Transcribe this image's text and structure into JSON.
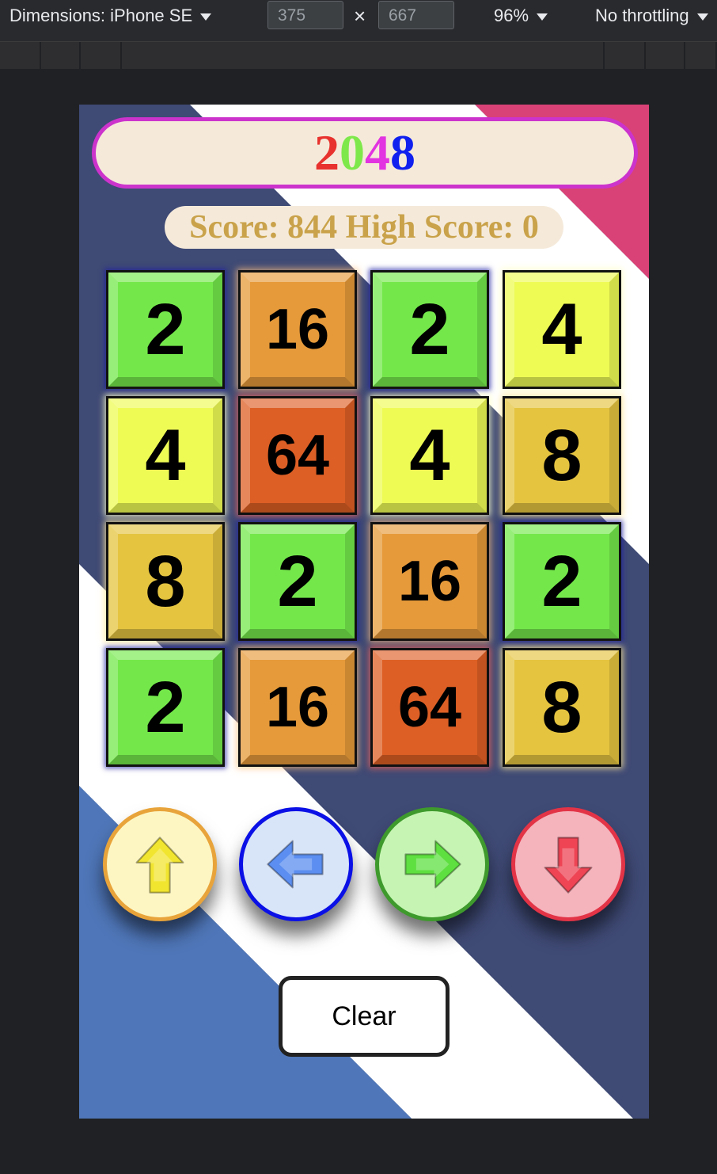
{
  "devtools": {
    "device_label": "Dimensions: iPhone SE",
    "width_value": "375",
    "height_value": "667",
    "times": "×",
    "zoom": "96%",
    "throttle": "No throttling"
  },
  "game": {
    "title_chars": [
      {
        "ch": "2",
        "color": "#e8322e"
      },
      {
        "ch": "0",
        "color": "#7ee84b"
      },
      {
        "ch": "4",
        "color": "#e234e0"
      },
      {
        "ch": "8",
        "color": "#1020ee"
      }
    ],
    "score_text": "Score: 844 High Score: 0",
    "board": [
      [
        "2",
        "16",
        "2",
        "4"
      ],
      [
        "4",
        "64",
        "4",
        "8"
      ],
      [
        "8",
        "2",
        "16",
        "2"
      ],
      [
        "2",
        "16",
        "64",
        "8"
      ]
    ],
    "controls": [
      {
        "name": "up-button",
        "icon": "arrow-up-icon",
        "fill": "#fdf6c3",
        "ring": "#e8a43a",
        "arrow": "#f2e530"
      },
      {
        "name": "left-button",
        "icon": "arrow-left-icon",
        "fill": "#d8e4f8",
        "ring": "#0a10e6",
        "arrow": "#5b8ef0"
      },
      {
        "name": "right-button",
        "icon": "arrow-right-icon",
        "fill": "#c6f5b3",
        "ring": "#3e9a2c",
        "arrow": "#5ee040"
      },
      {
        "name": "down-button",
        "icon": "arrow-down-icon",
        "fill": "#f5b3bc",
        "ring": "#e23446",
        "arrow": "#ee4454"
      }
    ],
    "clear_label": "Clear"
  }
}
